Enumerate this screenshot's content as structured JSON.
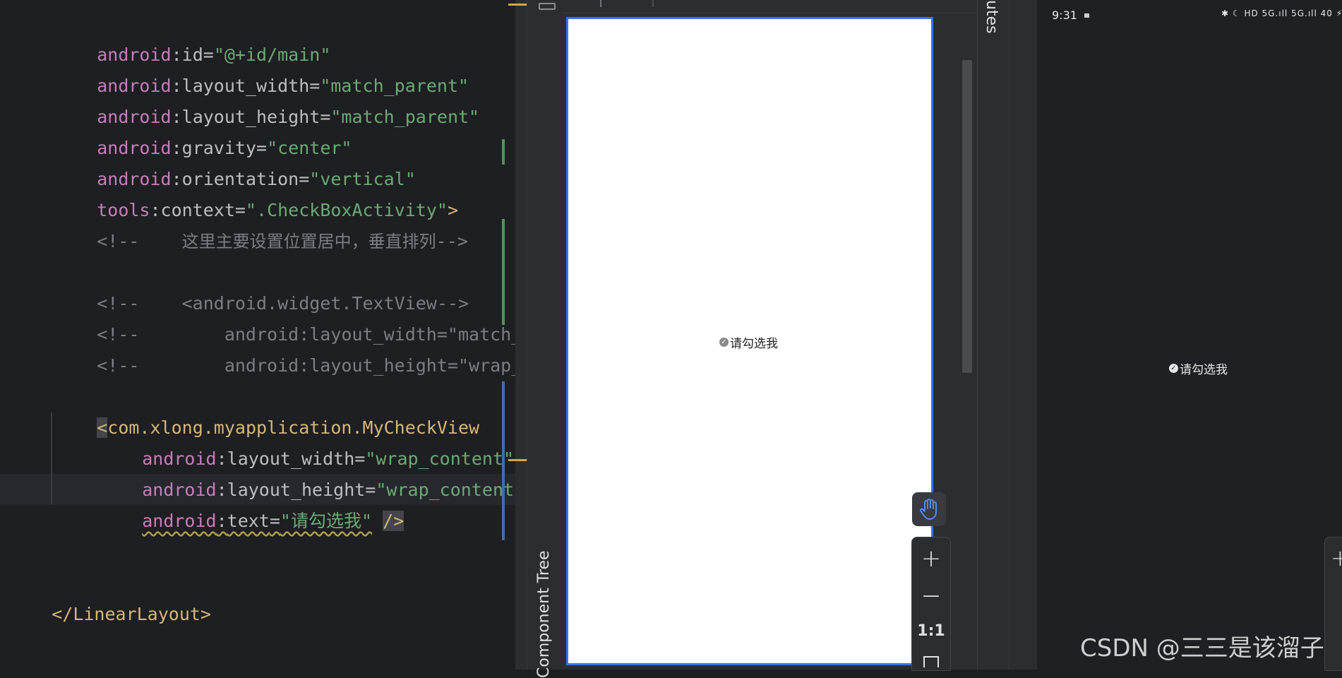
{
  "editor": {
    "lines": {
      "l1": {
        "ns": "android",
        "sep": ":",
        "name": "id",
        "eq": "=",
        "val": "\"@+id/main\""
      },
      "l2": {
        "ns": "android",
        "sep": ":",
        "name": "layout_width",
        "eq": "=",
        "val": "\"match_parent\""
      },
      "l3": {
        "ns": "android",
        "sep": ":",
        "name": "layout_height",
        "eq": "=",
        "val": "\"match_parent\""
      },
      "l4": {
        "ns": "android",
        "sep": ":",
        "name": "gravity",
        "eq": "=",
        "val": "\"center\""
      },
      "l5": {
        "ns": "android",
        "sep": ":",
        "name": "orientation",
        "eq": "=",
        "val": "\"vertical\""
      },
      "l6": {
        "ns": "tools",
        "sep": ":",
        "name": "context",
        "eq": "=",
        "val": "\".CheckBoxActivity\"",
        "close": ">"
      },
      "l7": {
        "open": "<!--    ",
        "text": "这里主要设置位置居中，垂直排列",
        "close": "-->"
      },
      "l9": {
        "text": "<!--    <android.widget.TextView-->"
      },
      "l10": {
        "text": "<!--        android:layout_width=\"match_pa"
      },
      "l11": {
        "text": "<!--        android:layout_height=\"wrap_co"
      },
      "l13": {
        "bracket": "<",
        "tag": "com.xlong.myapplication.MyCheckView"
      },
      "l14": {
        "ns": "android",
        "sep": ":",
        "name": "layout_width",
        "eq": "=",
        "val": "\"wrap_content\""
      },
      "l15": {
        "ns": "android",
        "sep": ":",
        "name": "layout_height",
        "eq": "=",
        "val": "\"wrap_content\""
      },
      "l16": {
        "ns": "android",
        "sep": ":",
        "name": "text",
        "eq": "=",
        "val": "\"请勾选我\"",
        "close": "/>"
      },
      "l19": {
        "tag": "</LinearLayout>"
      }
    }
  },
  "layout_editor": {
    "component_tree_label": "Component Tree",
    "preview_checkbox_text": "请勾选我",
    "zoom": {
      "plus": "+",
      "minus": "—",
      "one_to_one": "1:1"
    }
  },
  "attributes_label": "utes",
  "device": {
    "time": "9:31",
    "status_icons": "✱ ☾ HD 5G.ıll 5G.ıll 40 ⚡",
    "checkbox_text": "请勾选我",
    "zoom_plus": "+"
  },
  "watermark": "CSDN @三三是该溜子"
}
